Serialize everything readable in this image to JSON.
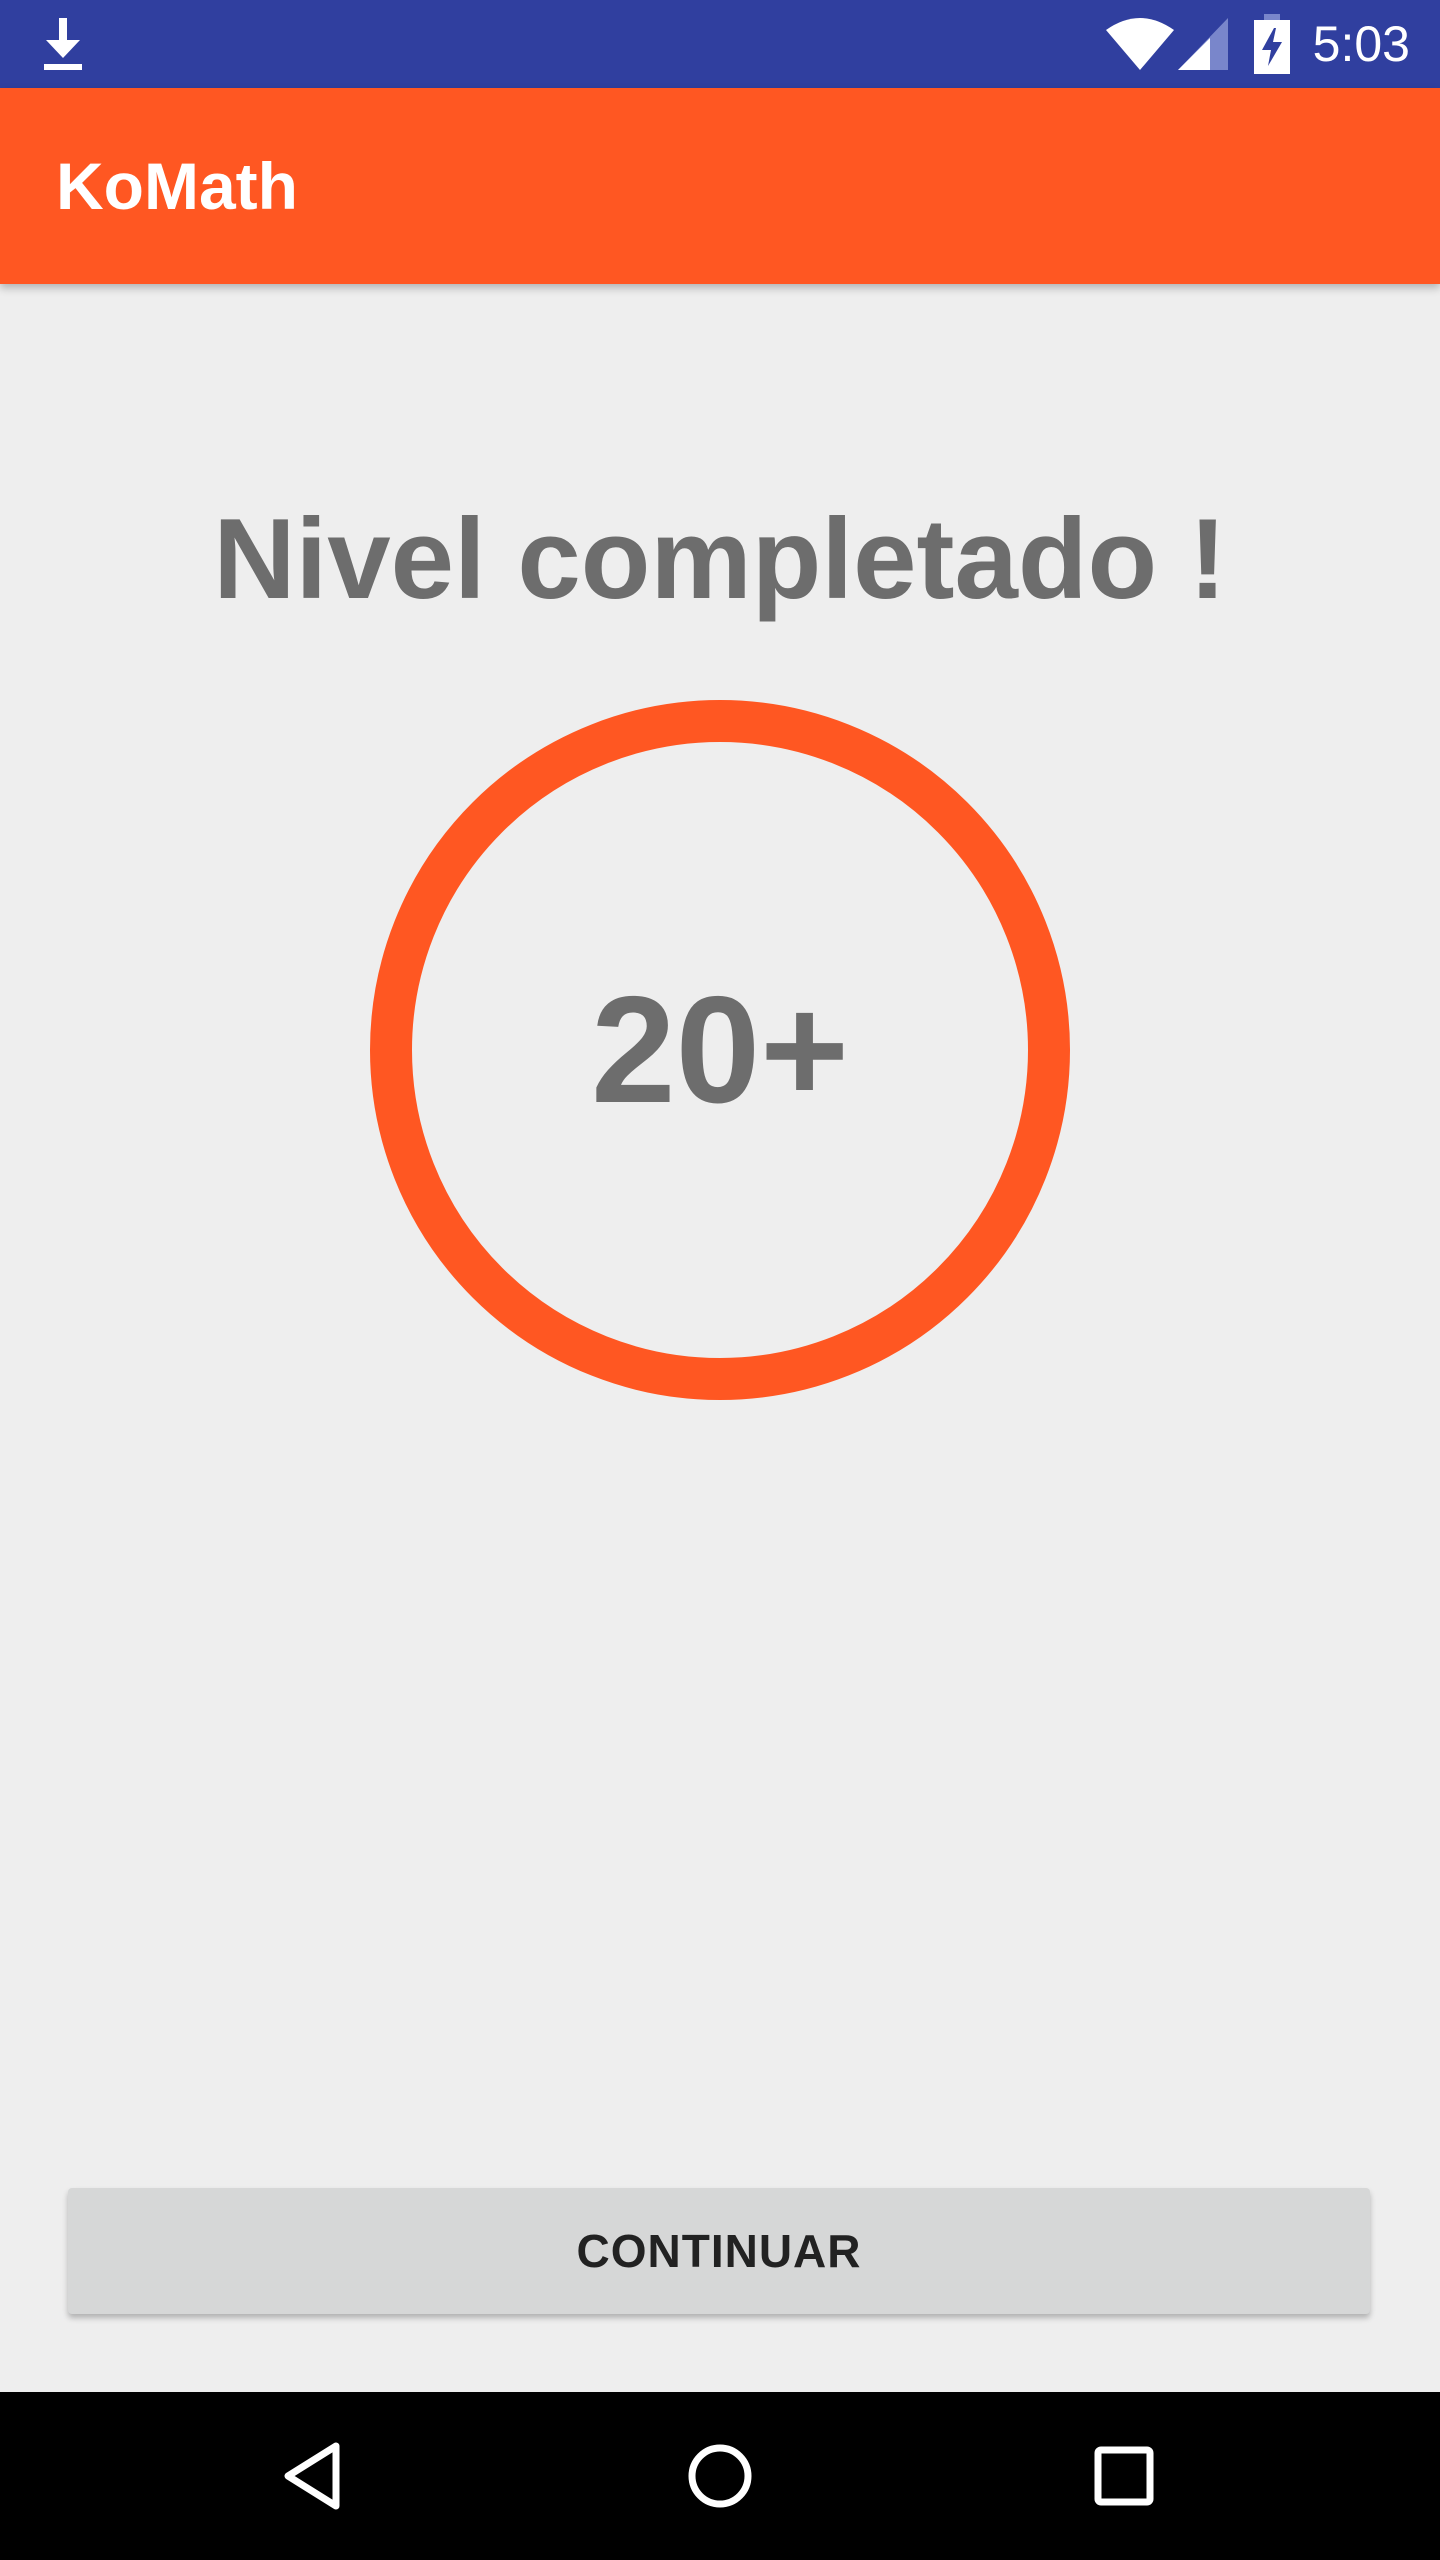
{
  "status_bar": {
    "time": "5:03",
    "icons": [
      "download-icon",
      "wifi-icon",
      "signal-icon",
      "battery-charging-icon"
    ],
    "background": "#303f9f"
  },
  "app_bar": {
    "title": "KoMath",
    "background": "#ff5722"
  },
  "main": {
    "heading": "Nivel completado !",
    "level_badge": "20+",
    "accent_color": "#ff5722",
    "text_color": "#6d6d6d"
  },
  "actions": {
    "continue_label": "CONTINUAR"
  },
  "nav_bar": {
    "icons": [
      "back-icon",
      "home-icon",
      "recents-icon"
    ]
  }
}
